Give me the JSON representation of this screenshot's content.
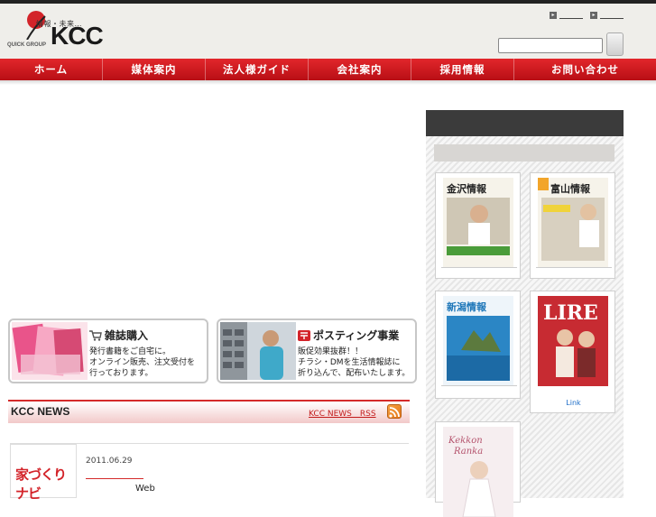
{
  "header": {
    "logo_tagline": "情報・未来…",
    "logo_text": "KCC",
    "logo_small": "QUICK GROUP",
    "search_placeholder": ""
  },
  "nav": {
    "items": [
      "ホーム",
      "媒体案内",
      "法人様ガイド",
      "会社案内",
      "採用情報",
      "お問い合わせ"
    ]
  },
  "banners": [
    {
      "title": "雑誌購入",
      "desc": "発行書籍をご自宅に。\nオンライン販売、注文受付を\n行っております。"
    },
    {
      "title": "ポスティング事業",
      "desc": "販促効果抜群！！\nチラシ・DMを生活情報誌に\n折り込んで、配布いたします。"
    }
  ],
  "news": {
    "title": "KCC NEWS",
    "links": "KCC NEWS　RSS",
    "thumb_text": "家づくりナビ",
    "date": "2011.06.29",
    "headline": "Web"
  },
  "sidebar": {
    "magazines": [
      {
        "title": "金沢情報",
        "caption": ""
      },
      {
        "title": "富山情報",
        "caption": ""
      },
      {
        "title": "新潟情報",
        "caption": ""
      },
      {
        "title": "LIRE",
        "caption": "Link"
      },
      {
        "title": "Kekkon Ranka",
        "caption": ""
      }
    ]
  },
  "colors": {
    "nav_red": "#d01c22",
    "header_bg": "#efeeea",
    "side_head": "#3b3b3b"
  }
}
